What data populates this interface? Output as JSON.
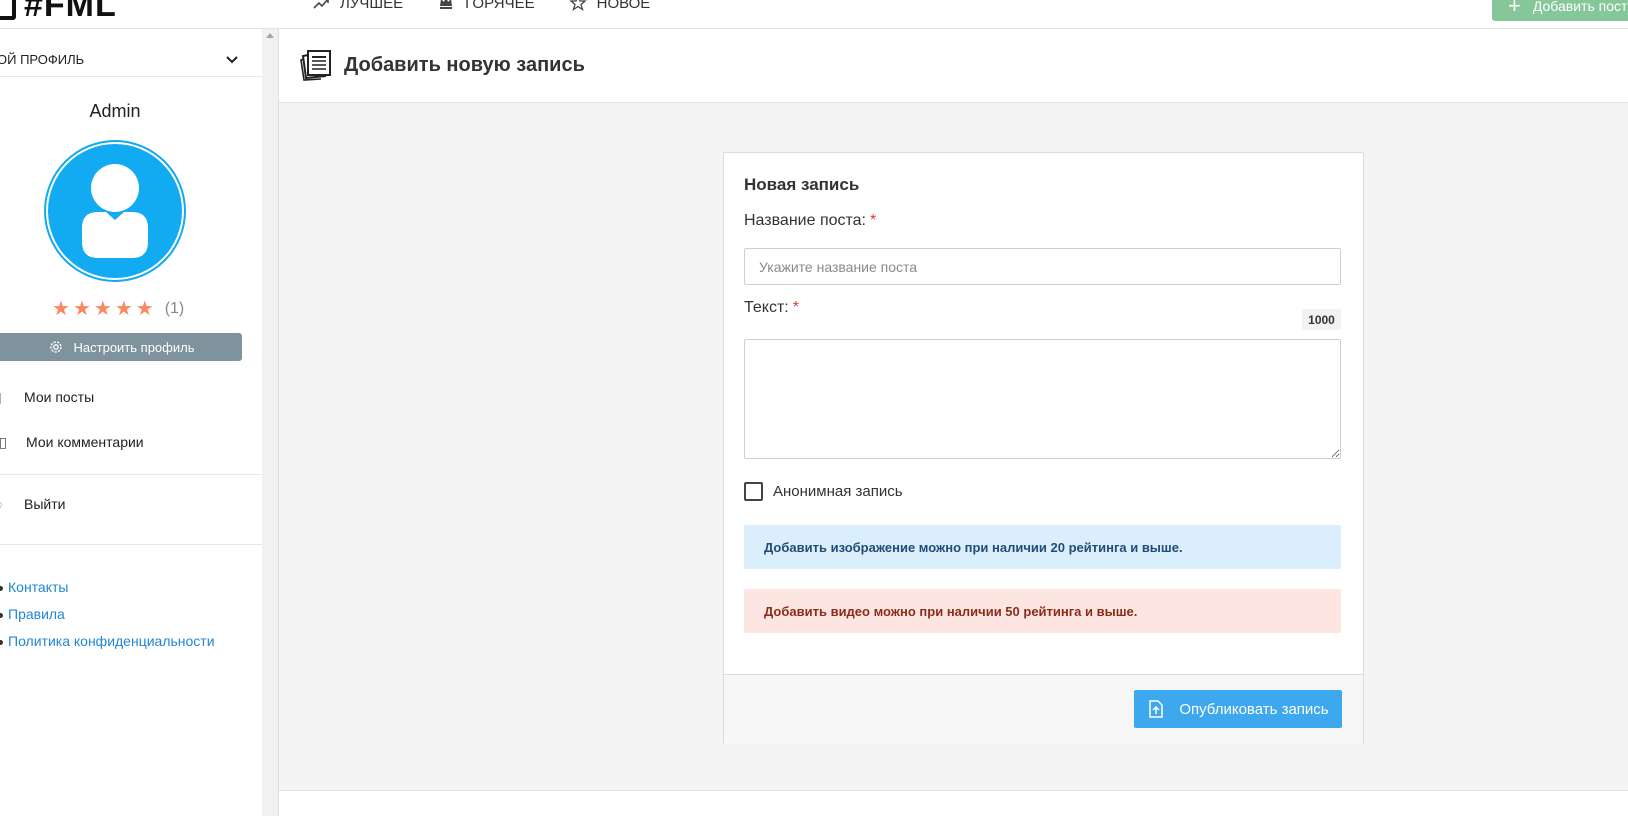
{
  "header": {
    "logo": "#FML",
    "nav": [
      {
        "label": "ЛУЧШЕЕ",
        "icon": "trending-up-icon"
      },
      {
        "label": "ГОРЯЧЕЕ",
        "icon": "crown-icon"
      },
      {
        "label": "НОВОЕ",
        "icon": "star-outline-icon"
      }
    ],
    "add_button": "Добавить пост"
  },
  "sidebar": {
    "profile_toggle": "ОЙ ПРОФИЛЬ",
    "username": "Admin",
    "rating_count": "(1)",
    "settings_button": "Настроить профиль",
    "menu": [
      {
        "label": "Мои посты",
        "icon": "document-icon"
      },
      {
        "label": "Мои комментарии",
        "icon": "comments-icon"
      }
    ],
    "logout": "Выйти",
    "links": [
      "Контакты",
      "Правила",
      "Политика конфиденциальности"
    ]
  },
  "page": {
    "title": "Добавить новую запись"
  },
  "form": {
    "card_title": "Новая запись",
    "title_label": "Название поста:",
    "title_placeholder": "Укажите название поста",
    "required_mark": "*",
    "text_label": "Текст:",
    "char_counter": "1000",
    "anonymous_label": "Анонимная запись",
    "info_alert": "Добавить изображение можно при наличии 20 рейтинга и выше.",
    "danger_alert": "Добавить видео можно при наличии 50 рейтинга и выше.",
    "publish_button": "Опубликовать запись"
  },
  "colors": {
    "accent": "#3ea8ef",
    "avatar": "#12aaf0",
    "star": "#f98961",
    "add_button": "#86c79a",
    "settings_button": "#7e939c"
  }
}
